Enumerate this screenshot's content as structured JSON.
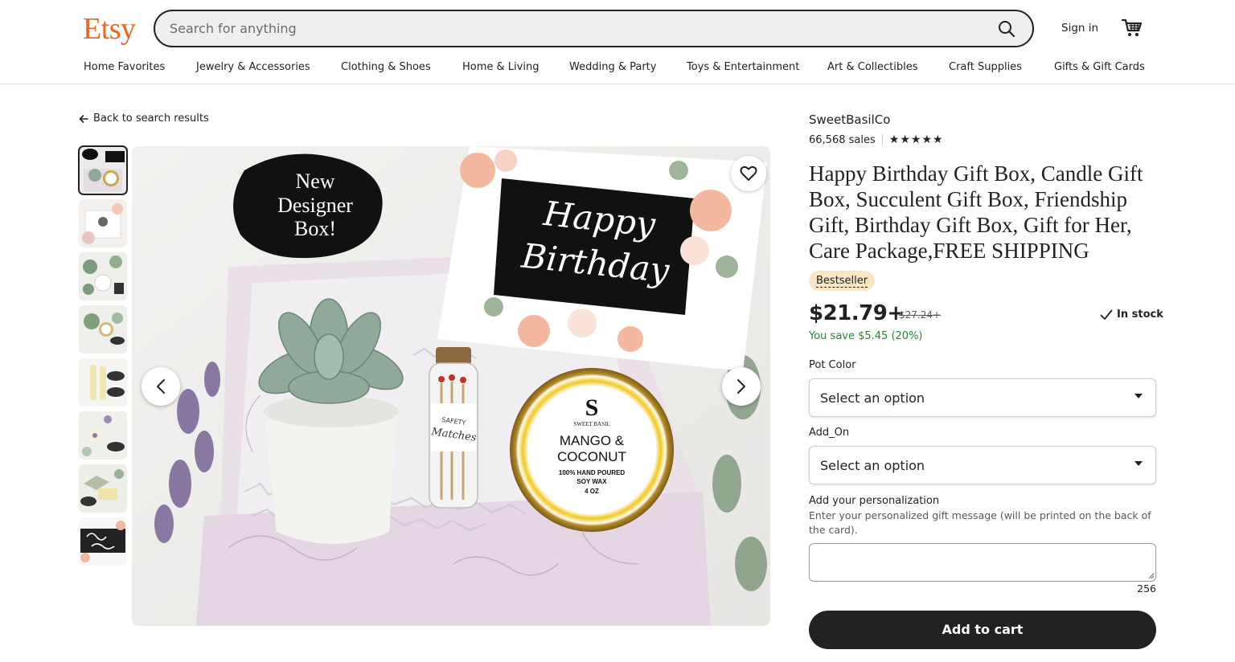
{
  "header": {
    "logo": "Etsy",
    "search_placeholder": "Search for anything",
    "signin_label": "Sign in"
  },
  "nav": {
    "items": [
      "Home Favorites",
      "Jewelry & Accessories",
      "Clothing & Shoes",
      "Home & Living",
      "Wedding & Party",
      "Toys & Entertainment",
      "Art & Collectibles",
      "Craft Supplies",
      "Gifts & Gift Cards"
    ]
  },
  "back_link": "Back to search results",
  "gallery": {
    "thumbnail_count": 8,
    "selected_index": 0,
    "main_image_text": {
      "badge": [
        "New",
        "Designer",
        "Box!"
      ],
      "card": [
        "Happy",
        "Birthday"
      ],
      "candle": [
        "SWEET BASIL",
        "MANGO &",
        "COCONUT",
        "100% HAND POURED",
        "SOY WAX",
        "4 OZ"
      ],
      "matches": "SAFETY Matches"
    }
  },
  "product": {
    "shop_name": "SweetBasilCo",
    "sales": "66,568 sales",
    "rating_stars": 5,
    "title": "Happy Birthday Gift Box, Candle Gift Box, Succulent Gift Box, Friendship Gift, Birthday Gift Box, Gift for Her, Care Package,FREE SHIPPING",
    "badge": "Bestseller",
    "price": "$21.79+",
    "original_price": "$27.24+",
    "stock": "In stock",
    "savings": "You save $5.45 (20%)"
  },
  "options": {
    "pot_color_label": "Pot Color",
    "pot_color_value": "Select an option",
    "addon_label": "Add_On",
    "addon_value": "Select an option"
  },
  "personalization": {
    "label": "Add your personalization",
    "help": "Enter your personalized gift message (will be printed on the back of the card).",
    "counter": "256"
  },
  "add_to_cart_label": "Add to cart",
  "colors": {
    "brand": "#f1641e",
    "savings": "#258635",
    "badge_bg": "#fbe6c4",
    "primary_button": "#222222"
  }
}
